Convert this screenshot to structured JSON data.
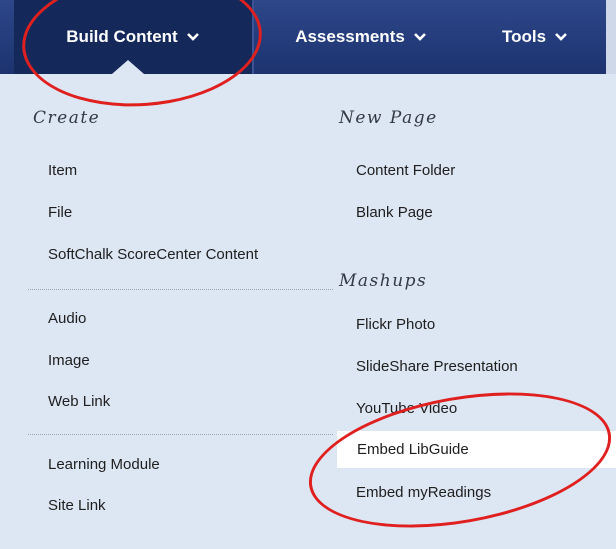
{
  "toolbar": {
    "build_content": "Build Content",
    "assessments": "Assessments",
    "tools": "Tools"
  },
  "icons": {
    "chevron": "chevron-down-icon"
  },
  "sections": {
    "create": {
      "heading": "Create",
      "group1": [
        "Item",
        "File",
        "SoftChalk ScoreCenter Content"
      ],
      "group2": [
        "Audio",
        "Image",
        "Web Link"
      ],
      "group3": [
        "Learning Module",
        "Site Link"
      ]
    },
    "new_page": {
      "heading": "New Page",
      "items": [
        "Content Folder",
        "Blank Page"
      ]
    },
    "mashups": {
      "heading": "Mashups",
      "items": [
        "Flickr Photo",
        "SlideShare Presentation",
        "YouTube Video",
        "Embed LibGuide",
        "Embed myReadings"
      ]
    }
  },
  "colors": {
    "toolbar_bg": "#1d3370",
    "active_tab": "#14285a",
    "menu_bg": "#dde6f3",
    "highlight_bg": "#ffffff",
    "annotation": "#e0201f"
  }
}
